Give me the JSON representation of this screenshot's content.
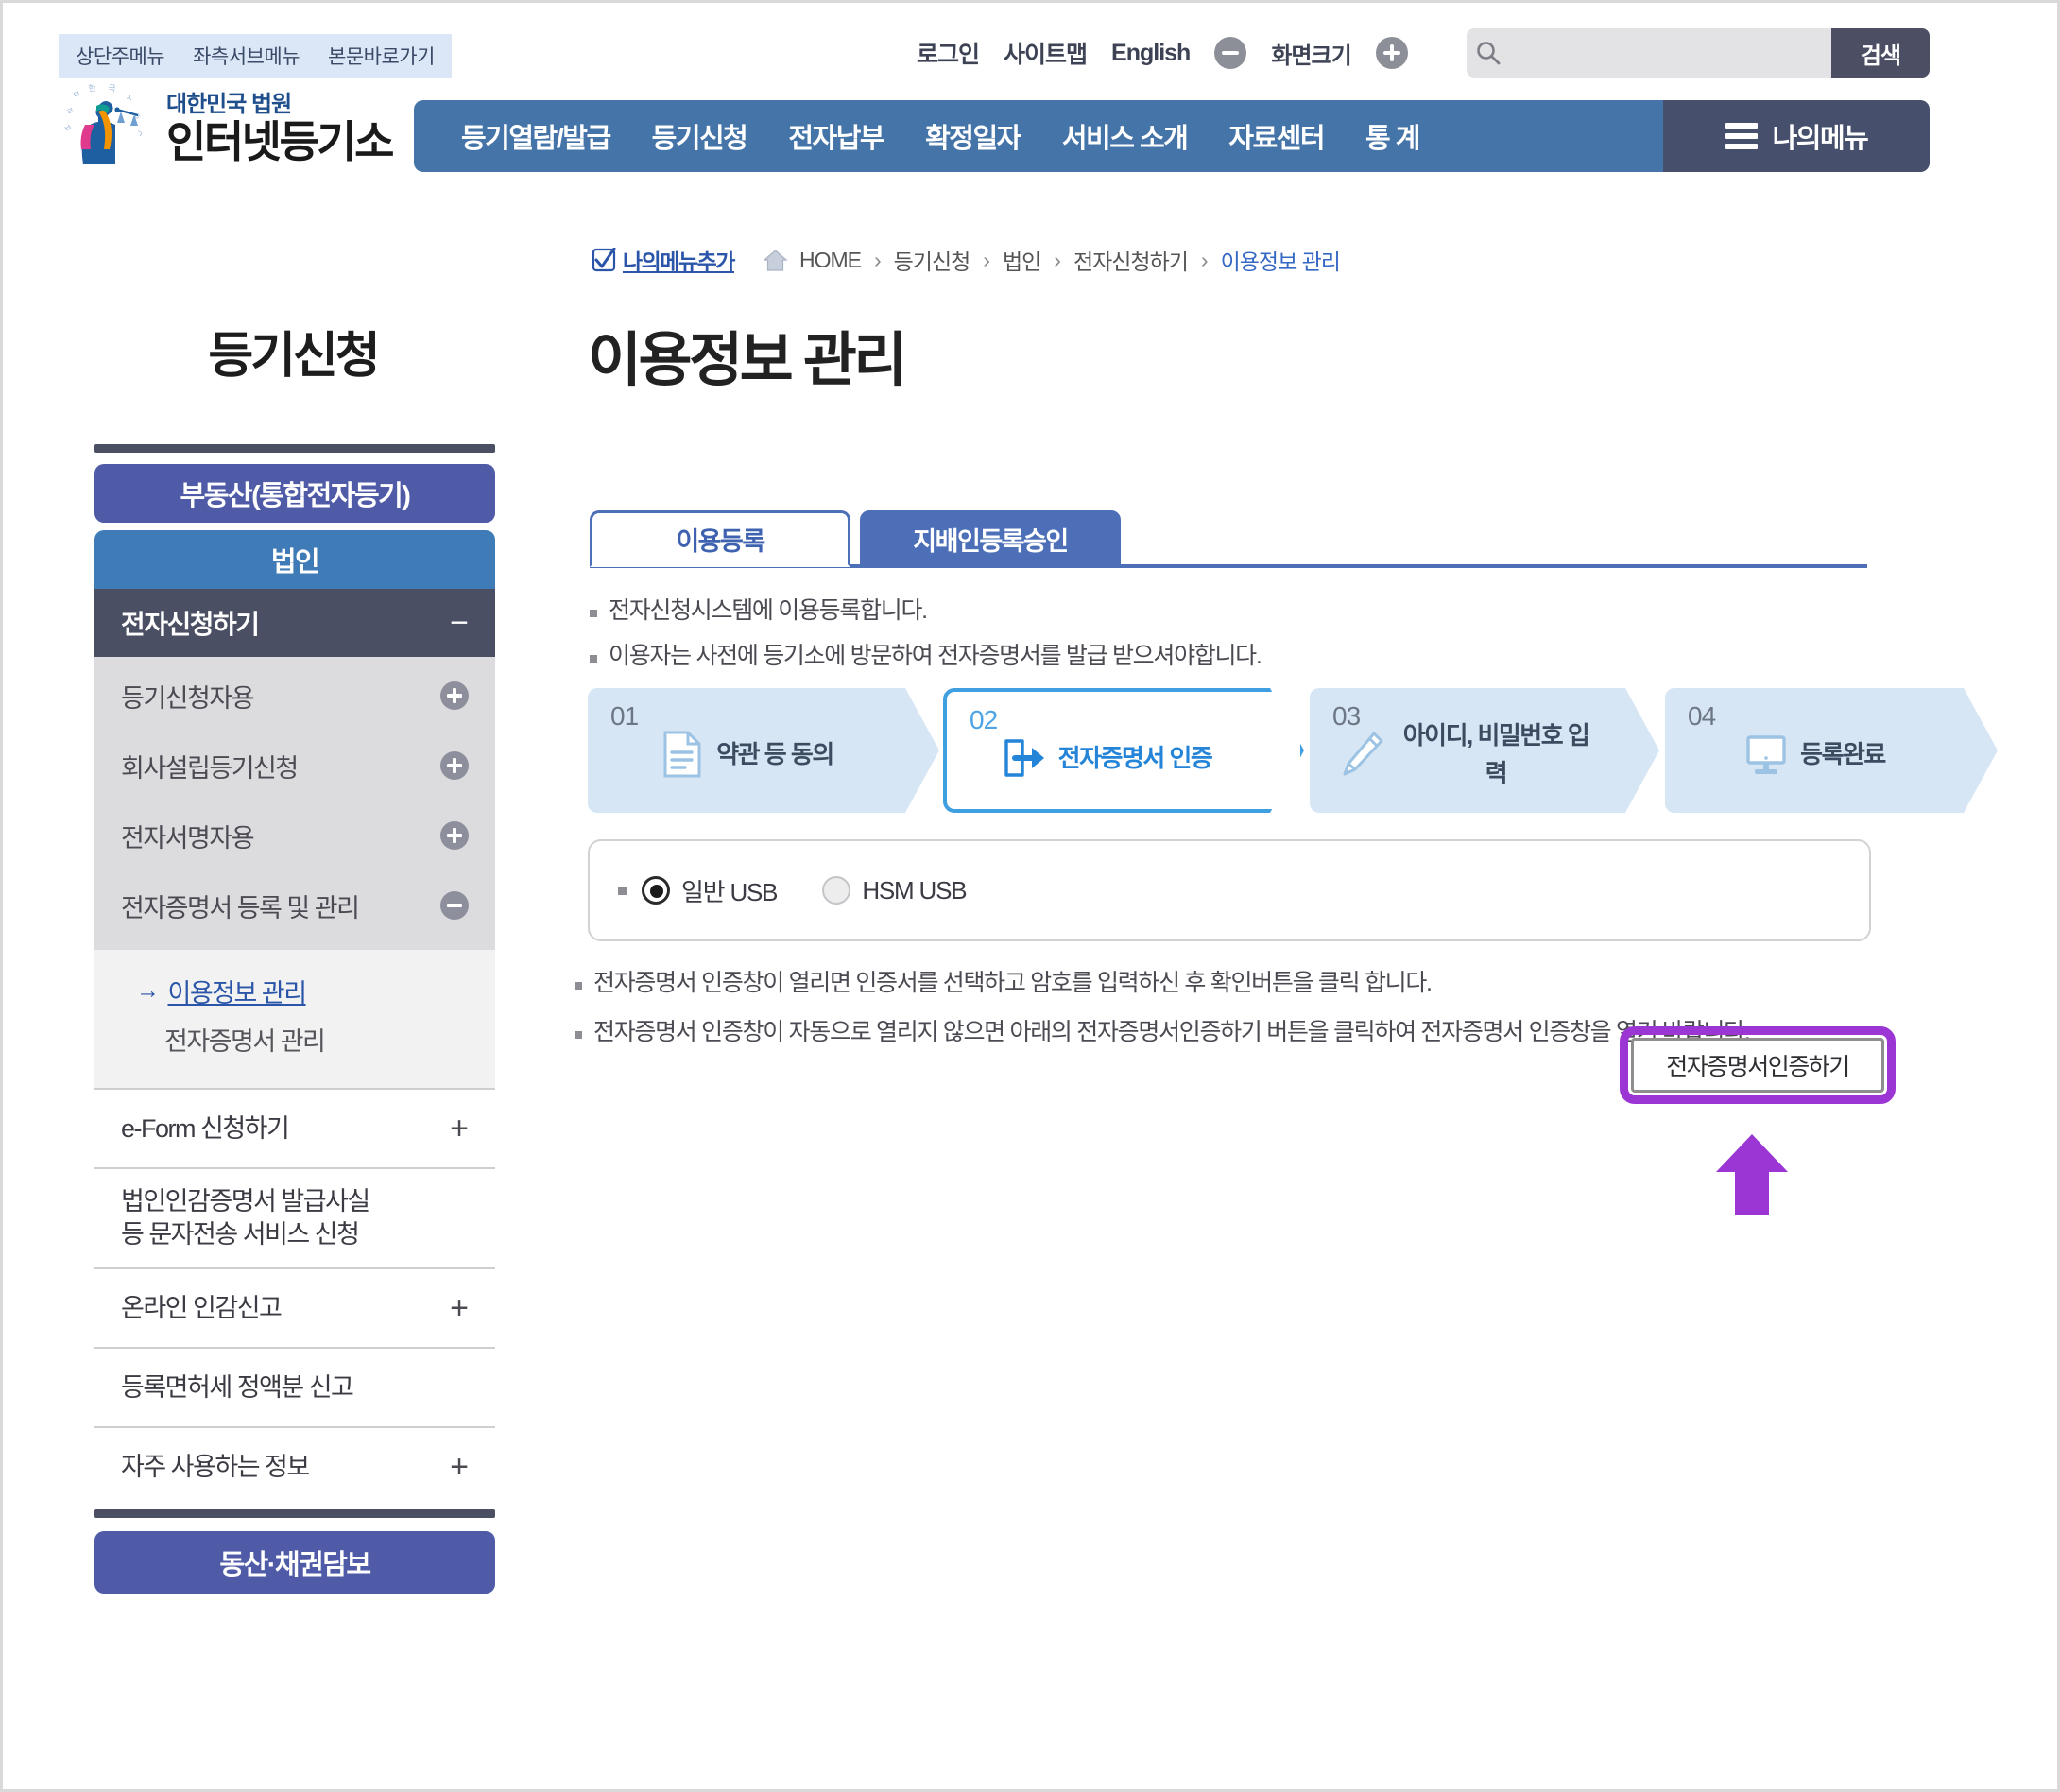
{
  "skip_links": [
    {
      "label": "상단주메뉴"
    },
    {
      "label": "좌측서브메뉴"
    },
    {
      "label": "본문바로가기"
    }
  ],
  "utility": {
    "login": "로그인",
    "sitemap": "사이트맵",
    "english": "English",
    "screen_size_label": "화면크기",
    "zoom_out_icon": "minus-circle-icon",
    "zoom_in_icon": "plus-circle-icon"
  },
  "search": {
    "placeholder": "",
    "value": "",
    "button_label": "검색",
    "icon": "search-icon"
  },
  "logo": {
    "line1": "대한민국 법원",
    "line2": "인터넷등기소",
    "mark": "court-emblem-icon"
  },
  "mainnav": {
    "items": [
      {
        "label": "등기열람/발급"
      },
      {
        "label": "등기신청"
      },
      {
        "label": "전자납부"
      },
      {
        "label": "확정일자"
      },
      {
        "label": "서비스 소개"
      },
      {
        "label": "자료센터"
      },
      {
        "label": "통 계"
      }
    ],
    "mymenu_label": "나의메뉴",
    "mymenu_icon": "hamburger-icon"
  },
  "breadcrumb": {
    "add_mymenu_label": "나의메뉴추가",
    "add_mymenu_icon": "checkbox-check-icon",
    "home_icon": "home-icon",
    "home_label": "HOME",
    "separator": "›",
    "items": [
      {
        "label": "등기신청",
        "current": false
      },
      {
        "label": "법인",
        "current": false
      },
      {
        "label": "전자신청하기",
        "current": false
      },
      {
        "label": "이용정보 관리",
        "current": true
      }
    ]
  },
  "sidebar": {
    "title": "등기신청",
    "categories": [
      {
        "label": "부동산(통합전자등기)",
        "style": "real"
      },
      {
        "label": "법인",
        "style": "corp"
      }
    ],
    "section": {
      "label": "전자신청하기",
      "toggle_icon": "minus-icon"
    },
    "sub_items": [
      {
        "label": "등기신청자용",
        "toggle": "plus"
      },
      {
        "label": "회사설립등기신청",
        "toggle": "plus"
      },
      {
        "label": "전자서명자용",
        "toggle": "plus"
      },
      {
        "label": "전자증명서 등록 및 관리",
        "toggle": "minus"
      }
    ],
    "leaf_items": [
      {
        "label": "이용정보 관리",
        "active": true,
        "arrow": "→"
      },
      {
        "label": "전자증명서 관리",
        "active": false,
        "arrow": ""
      }
    ],
    "plain_items": [
      {
        "label": "e-Form 신청하기",
        "toggle": "+"
      },
      {
        "label": "법인인감증명서 발급사실\n등 문자전송 서비스 신청",
        "toggle": ""
      },
      {
        "label": "온라인 인감신고",
        "toggle": "+"
      },
      {
        "label": "등록면허세 정액분 신고",
        "toggle": ""
      },
      {
        "label": "자주 사용하는 정보",
        "toggle": "+"
      }
    ],
    "bottom_category": {
      "label": "동산·채권담보"
    }
  },
  "main": {
    "page_title": "이용정보 관리",
    "tabs": [
      {
        "label": "이용등록",
        "active": true
      },
      {
        "label": "지배인등록승인",
        "active": false
      }
    ],
    "intro_bullets": [
      {
        "text": "전자신청시스템에 이용등록합니다."
      },
      {
        "text": "이용자는 사전에 등기소에 방문하여 전자증명서를 발급 받으셔야합니다."
      }
    ],
    "steps": [
      {
        "num": "01",
        "label": "약관 등 동의",
        "icon": "document-icon",
        "current": false
      },
      {
        "num": "02",
        "label": "전자증명서 인증",
        "icon": "login-arrow-icon",
        "current": true
      },
      {
        "num": "03",
        "label": "아이디, 비밀번호 입력",
        "icon": "pencil-icon",
        "current": false
      },
      {
        "num": "04",
        "label": "등록완료",
        "icon": "monitor-icon",
        "current": false
      }
    ],
    "usb_options": [
      {
        "label": "일반 USB",
        "checked": true
      },
      {
        "label": "HSM USB",
        "checked": false
      }
    ],
    "notes": [
      {
        "text": "전자증명서 인증창이 열리면 인증서를 선택하고 암호를 입력하신 후 확인버튼을 클릭 합니다."
      },
      {
        "text": "전자증명서 인증창이 자동으로 열리지 않으면 아래의 전자증명서인증하기 버튼을 클릭하여 전자증명서 인증창을 열기 바랍니다."
      }
    ],
    "cert_button": {
      "label": "전자증명서인증하기",
      "highlight_color": "#9b35d4",
      "annotation_arrow_icon": "up-arrow-icon"
    }
  },
  "colors": {
    "nav_blue": "#4575a8",
    "nav_dark": "#46506d",
    "tab_blue": "#4c6fb8",
    "sidebar_purple": "#4f5ba6",
    "sidebar_blue": "#3f7bb6",
    "sidebar_dark": "#4b4f63",
    "step_active": "#3f9fe0",
    "highlight_purple": "#9b35d4",
    "link_blue": "#2b55a8"
  }
}
